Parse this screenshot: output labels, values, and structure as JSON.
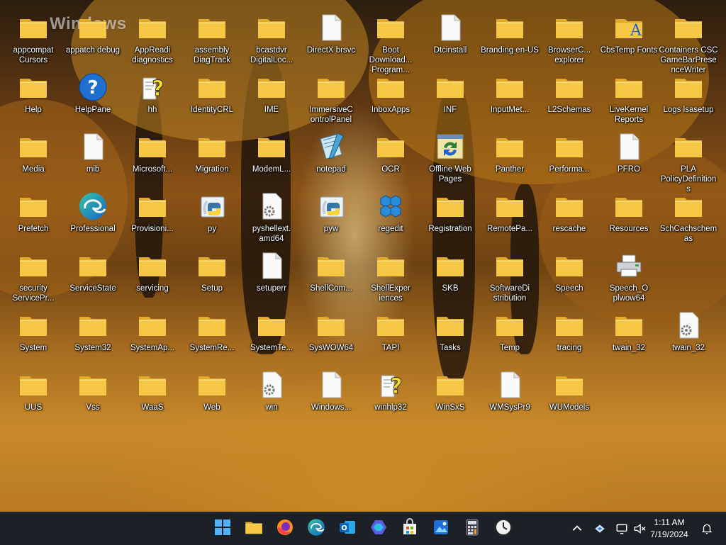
{
  "desktop": {
    "watermark": "Windows",
    "rows": [
      [
        {
          "label": "appcompat Cursors",
          "icon": "folder-icon"
        },
        {
          "label": "appatch debug",
          "icon": "folder-icon"
        },
        {
          "label": "AppReadi diagnostics",
          "icon": "folder-icon"
        },
        {
          "label": "assembly DiagTrack",
          "icon": "folder-icon"
        },
        {
          "label": "bcastdvr DigitalLoc...",
          "icon": "folder-icon"
        },
        {
          "label": "DirectX brsvc",
          "icon": "file-icon"
        },
        {
          "label": "Boot Download... Program...",
          "icon": "folder-icon"
        },
        {
          "label": "Dtcinstall",
          "icon": "file-icon"
        },
        {
          "label": "Branding en-US",
          "icon": "folder-icon"
        },
        {
          "label": "BrowserC... explorer",
          "icon": "folder-icon"
        },
        {
          "label": "CbsTemp Fonts",
          "icon": "fonts-folder-icon"
        },
        {
          "label": "Containers CSC GameBarPresenceWriter",
          "icon": "folder-icon"
        }
      ],
      [
        {
          "label": "Help",
          "icon": "folder-icon"
        },
        {
          "label": "HelpPane",
          "icon": "help-icon"
        },
        {
          "label": "hh",
          "icon": "help-file-icon"
        },
        {
          "label": "IdentityCRL",
          "icon": "folder-icon"
        },
        {
          "label": "IME",
          "icon": "folder-icon"
        },
        {
          "label": "ImmersiveC ontrolPanel",
          "icon": "folder-icon"
        },
        {
          "label": "InboxApps",
          "icon": "folder-icon"
        },
        {
          "label": "INF",
          "icon": "folder-icon"
        },
        {
          "label": "InputMet...",
          "icon": "folder-icon"
        },
        {
          "label": "L2Schemas",
          "icon": "folder-icon"
        },
        {
          "label": "LiveKernel Reports",
          "icon": "folder-icon"
        },
        {
          "label": "Logs lsasetup",
          "icon": "folder-icon"
        }
      ],
      [
        {
          "label": "Media",
          "icon": "folder-icon"
        },
        {
          "label": "mib",
          "icon": "file-icon"
        },
        {
          "label": "Microsoft...",
          "icon": "folder-icon"
        },
        {
          "label": "Migration",
          "icon": "folder-icon"
        },
        {
          "label": "ModemL...",
          "icon": "folder-icon"
        },
        {
          "label": "notepad",
          "icon": "notepad-icon"
        },
        {
          "label": "OCR",
          "icon": "folder-icon"
        },
        {
          "label": "Offline Web Pages",
          "icon": "offline-pages-icon"
        },
        {
          "label": "Panther",
          "icon": "folder-icon"
        },
        {
          "label": "Performa...",
          "icon": "folder-icon"
        },
        {
          "label": "PFRO",
          "icon": "file-icon"
        },
        {
          "label": "PLA PolicyDefinitions",
          "icon": "folder-icon"
        }
      ],
      [
        {
          "label": "Prefetch",
          "icon": "folder-icon"
        },
        {
          "label": "Professional",
          "icon": "edge-icon"
        },
        {
          "label": "Provisioni...",
          "icon": "folder-icon"
        },
        {
          "label": "py",
          "icon": "python-icon"
        },
        {
          "label": "pyshellext. amd64",
          "icon": "settings-file-icon"
        },
        {
          "label": "pyw",
          "icon": "python-icon"
        },
        {
          "label": "regedit",
          "icon": "regedit-icon"
        },
        {
          "label": "Registration",
          "icon": "folder-icon"
        },
        {
          "label": "RemotePa...",
          "icon": "folder-icon"
        },
        {
          "label": "rescache",
          "icon": "folder-icon"
        },
        {
          "label": "Resources",
          "icon": "folder-icon"
        },
        {
          "label": "SchCachschemas",
          "icon": "folder-icon"
        }
      ],
      [
        {
          "label": "security ServicePr...",
          "icon": "folder-icon"
        },
        {
          "label": "ServiceState",
          "icon": "folder-icon"
        },
        {
          "label": "servicing",
          "icon": "folder-icon"
        },
        {
          "label": "Setup",
          "icon": "folder-icon"
        },
        {
          "label": "setuperr",
          "icon": "file-icon"
        },
        {
          "label": "ShellCom...",
          "icon": "folder-icon"
        },
        {
          "label": "ShellExper iences",
          "icon": "folder-icon"
        },
        {
          "label": "SKB",
          "icon": "folder-icon"
        },
        {
          "label": "SoftwareDi stribution",
          "icon": "folder-icon"
        },
        {
          "label": "Speech",
          "icon": "folder-icon"
        },
        {
          "label": "Speech_O plwow64",
          "icon": "printer-icon"
        }
      ],
      [
        {
          "label": "System",
          "icon": "folder-icon"
        },
        {
          "label": "System32",
          "icon": "folder-icon"
        },
        {
          "label": "SystemAp...",
          "icon": "folder-icon"
        },
        {
          "label": "SystemRe...",
          "icon": "folder-icon"
        },
        {
          "label": "SystemTe...",
          "icon": "folder-icon"
        },
        {
          "label": "SysWOW64",
          "icon": "folder-icon"
        },
        {
          "label": "TAPI",
          "icon": "folder-icon"
        },
        {
          "label": "Tasks",
          "icon": "folder-icon"
        },
        {
          "label": "Temp",
          "icon": "folder-icon"
        },
        {
          "label": "tracing",
          "icon": "folder-icon"
        },
        {
          "label": "twain_32",
          "icon": "folder-icon"
        },
        {
          "label": "twain_32",
          "icon": "settings-file-icon"
        }
      ],
      [
        {
          "label": "UUS",
          "icon": "folder-icon"
        },
        {
          "label": "Vss",
          "icon": "folder-icon"
        },
        {
          "label": "WaaS",
          "icon": "folder-icon"
        },
        {
          "label": "Web",
          "icon": "folder-icon"
        },
        {
          "label": "win",
          "icon": "settings-file-icon"
        },
        {
          "label": "Windows...",
          "icon": "file-icon"
        },
        {
          "label": "winhlp32",
          "icon": "help-file-icon"
        },
        {
          "label": "WinSxS",
          "icon": "folder-icon"
        },
        {
          "label": "WMSysPr9",
          "icon": "file-icon"
        },
        {
          "label": "WUModels",
          "icon": "folder-icon"
        }
      ]
    ]
  },
  "taskbar": {
    "apps": [
      {
        "name": "start-button",
        "icon": "windows-logo-icon"
      },
      {
        "name": "file-explorer",
        "icon": "folder-icon"
      },
      {
        "name": "firefox",
        "icon": "firefox-icon"
      },
      {
        "name": "edge",
        "icon": "edge-icon"
      },
      {
        "name": "outlook",
        "icon": "outlook-icon"
      },
      {
        "name": "copilot",
        "icon": "copilot-icon"
      },
      {
        "name": "microsoft-store",
        "icon": "store-icon"
      },
      {
        "name": "photos",
        "icon": "photos-icon"
      },
      {
        "name": "calculator",
        "icon": "calculator-icon"
      },
      {
        "name": "clock-app",
        "icon": "clock-icon"
      }
    ],
    "clock": {
      "time": "1:11 AM",
      "date": "7/19/2024"
    }
  },
  "colors": {
    "folder": "#f6c744",
    "folder_dark": "#e3a92a",
    "taskbar": "#1c2027"
  }
}
